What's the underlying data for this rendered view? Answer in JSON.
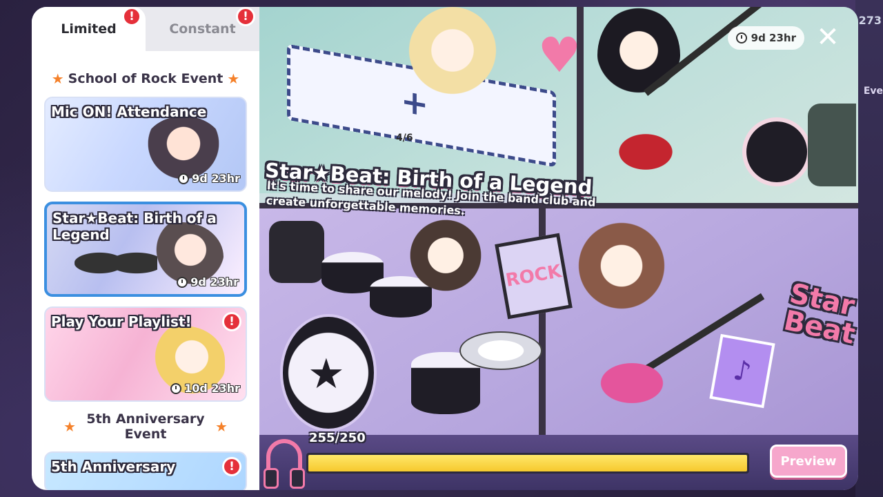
{
  "tabs": [
    {
      "label": "Limited",
      "active": true,
      "alert": "!"
    },
    {
      "label": "Constant",
      "active": false,
      "alert": "!"
    }
  ],
  "sections": [
    {
      "title": "School of Rock Event"
    },
    {
      "title": "5th Anniversary Event"
    }
  ],
  "events": [
    {
      "title": "Mic ON! Attendance",
      "timer": "9d 23hr",
      "selected": false,
      "alert": null
    },
    {
      "title": "Star★Beat: Birth of a Legend",
      "timer": "9d 23hr",
      "selected": true,
      "alert": null
    },
    {
      "title": "Play Your Playlist!",
      "timer": "10d 23hr",
      "selected": false,
      "alert": "!"
    },
    {
      "title": "5th Anniversary",
      "timer": null,
      "selected": false,
      "alert": "!"
    }
  ],
  "banner": {
    "timer": "9d 23hr",
    "close_label": "✕",
    "title": "Star★Beat: Birth of a Legend",
    "description": "It's time to share our melody! Join the band club and create unforgettable memories.",
    "keyboard_count": "4/6",
    "logo_text": "Star Beat",
    "rock_sticker": "ROCK",
    "progress_label": "255/250",
    "progress_fraction": 1.0,
    "preview_label": "Preview"
  },
  "background": {
    "counter_text": "273",
    "event_label": "Eve"
  },
  "colors": {
    "accent_pink": "#f27aa9",
    "progress_yellow": "#f6c92d",
    "selected_border": "#3b8fe0",
    "alert_red": "#e5303a"
  }
}
